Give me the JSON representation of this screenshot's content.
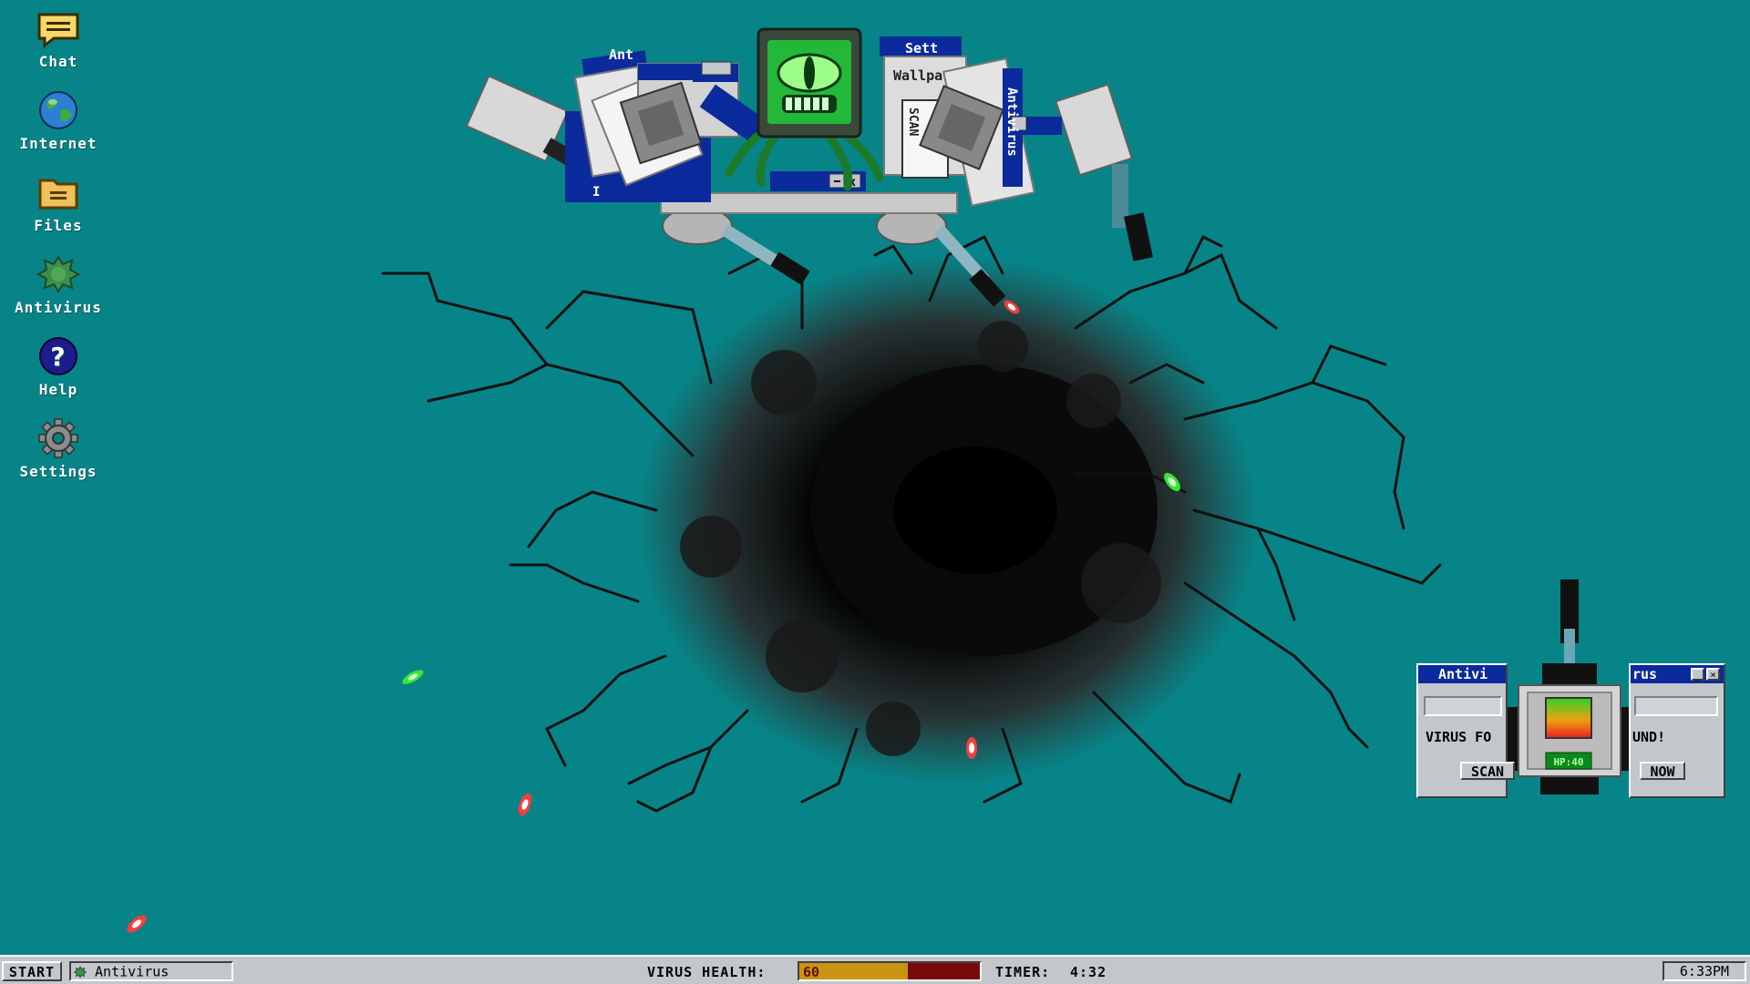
{
  "desktop": {
    "icons": [
      {
        "label": "Chat",
        "icon": "chat-icon"
      },
      {
        "label": "Internet",
        "icon": "globe-icon"
      },
      {
        "label": "Files",
        "icon": "folder-icon"
      },
      {
        "label": "Antivirus",
        "icon": "antivirus-icon"
      },
      {
        "label": "Help",
        "icon": "help-icon"
      },
      {
        "label": "Settings",
        "icon": "gear-icon"
      }
    ],
    "background_color": "#078487"
  },
  "boss": {
    "window_titles": [
      "Ant",
      "Sett",
      "Antivirus",
      "Wallpa",
      "SCAN"
    ],
    "window_partial_text": "I",
    "icon": "virus-monitor-icon"
  },
  "turret": {
    "left_window": {
      "title": "Antivi",
      "line1": "VIRUS FO",
      "button": "SCAN"
    },
    "right_window": {
      "title": "rus",
      "line1": "UND!",
      "button": "NOW"
    },
    "hp_label": "HP:40",
    "hp_value": 40
  },
  "projectiles": {
    "colors": [
      "#ff3b3b",
      "#35e635"
    ]
  },
  "taskbar": {
    "start_label": "START",
    "task_label": "Antivirus",
    "virus_health_label": "VIRUS HEALTH:",
    "virus_health_value": "60",
    "virus_health_fraction": 0.6,
    "timer_label": "TIMER:",
    "timer_value": "4:32",
    "clock": "6:33PM"
  }
}
